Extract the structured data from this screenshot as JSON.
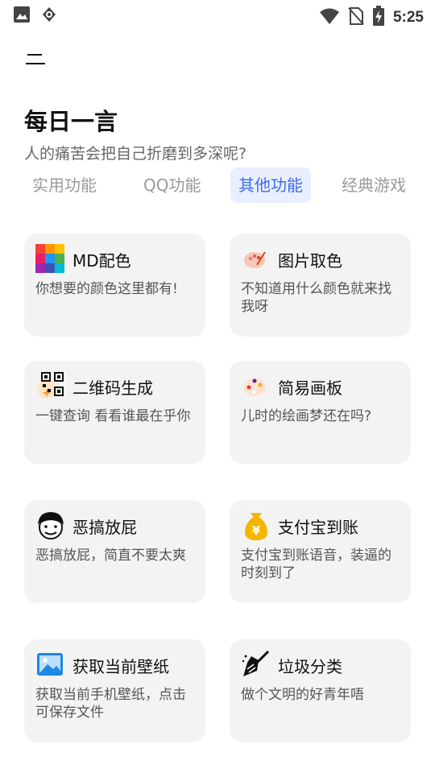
{
  "status": {
    "time": "5:25",
    "left_icons": [
      "gallery-icon",
      "target-icon"
    ],
    "right_icons": [
      "wifi-icon",
      "no-sim-icon",
      "battery-charging-icon"
    ]
  },
  "header": {
    "menu_icon": "menu-icon",
    "title": "每日一言",
    "subtitle": "人的痛苦会把自己折磨到多深呢?"
  },
  "tabs": [
    {
      "label": "实用功能",
      "active": false
    },
    {
      "label": "QQ功能",
      "active": false
    },
    {
      "label": "其他功能",
      "active": true
    },
    {
      "label": "经典游戏",
      "active": false
    }
  ],
  "cards": [
    {
      "title": "MD配色",
      "desc": "你想要的颜色这里都有!",
      "icon": "color-palette-grid-icon"
    },
    {
      "title": "图片取色",
      "desc": "不知道用什么颜色就来找我呀",
      "icon": "paint-palette-icon"
    },
    {
      "title": "二维码生成",
      "desc": "一键查询 看看谁最在乎你",
      "icon": "qr-code-icon"
    },
    {
      "title": "简易画板",
      "desc": "儿时的绘画梦还在吗?",
      "icon": "drawing-board-icon"
    },
    {
      "title": "恶搞放屁",
      "desc": "恶搞放屁，简直不要太爽",
      "icon": "meme-face-icon"
    },
    {
      "title": "支付宝到账",
      "desc": "支付宝到账语音，装逼的时刻到了",
      "icon": "money-bag-icon"
    },
    {
      "title": "获取当前壁纸",
      "desc": "获取当前手机壁纸，点击可保存文件",
      "icon": "wallpaper-image-icon"
    },
    {
      "title": "垃圾分类",
      "desc": "做个文明的好青年唔",
      "icon": "broom-icon"
    }
  ],
  "colors": {
    "accent": "#3d6cf0",
    "tab_active_bg": "#e9efff",
    "card_bg": "#f3f3f3"
  }
}
